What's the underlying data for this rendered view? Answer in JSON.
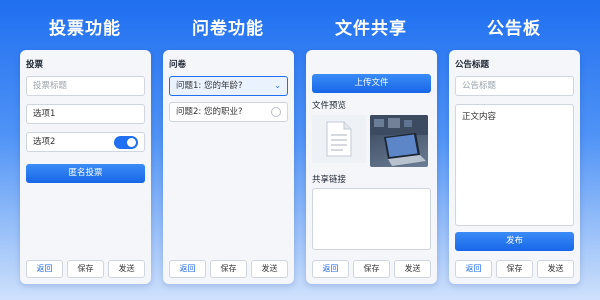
{
  "titles": {
    "vote": "投票功能",
    "survey": "问卷功能",
    "share": "文件共享",
    "notice": "公告板"
  },
  "vote": {
    "label": "投票",
    "title_placeholder": "投票标题",
    "option1": "选项1",
    "option2": "选项2",
    "option2_toggle": "on",
    "submit": "匿名投票"
  },
  "survey": {
    "label": "问卷",
    "q1": "问题1: 您的年龄?",
    "q2": "问题2: 您的职业?"
  },
  "share": {
    "upload": "上传文件",
    "preview_label": "文件预览",
    "link_label": "共享链接"
  },
  "notice": {
    "label": "公告标题",
    "title_placeholder": "公告标题",
    "body": "正文内容",
    "publish": "发布"
  },
  "footer": {
    "back": "返回",
    "save": "保存",
    "send": "发送"
  },
  "colors": {
    "accent": "#1f6ff0",
    "card": "#f4f6fa"
  }
}
